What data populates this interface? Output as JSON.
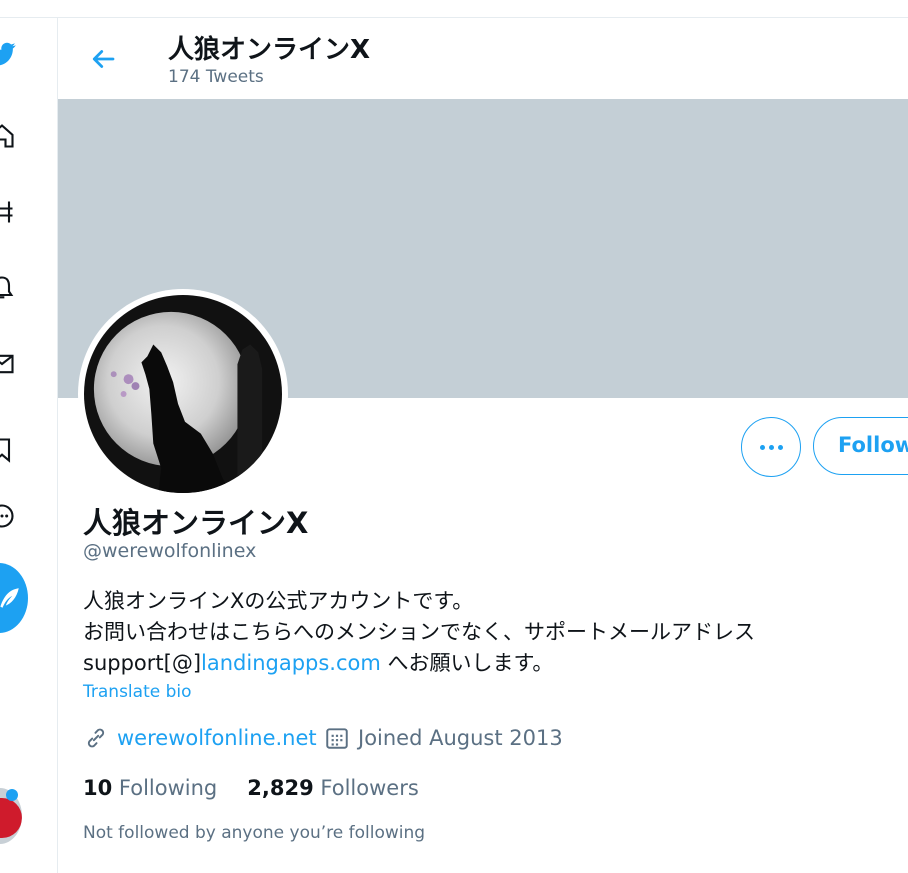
{
  "header": {
    "title": "人狼オンラインX",
    "tweet_count": "174 Tweets"
  },
  "profile": {
    "name": "人狼オンラインX",
    "handle": "@werewolfonlinex",
    "bio_line1": "人狼オンラインXの公式アカウントです。",
    "bio_line2": "お問い合わせはこちらへのメンションでなく、サポートメールアドレス",
    "bio_line3_prefix": "support[@]",
    "bio_line3_link": "landingapps.com",
    "bio_line3_suffix": " へお願いします。",
    "translate": "Translate bio",
    "website": "werewolfonline.net",
    "joined": "Joined August 2013",
    "following_count": "10",
    "following_label": "Following",
    "followers_count": "2,829",
    "followers_label": "Followers",
    "not_followed": "Not followed by anyone you’re following"
  },
  "actions": {
    "follow_label": "Follow"
  },
  "icons": [
    "twitter-logo-icon",
    "home-icon",
    "explore-icon",
    "notifications-icon",
    "messages-icon",
    "bookmarks-icon",
    "more-circle-icon",
    "compose-tweet-icon",
    "back-arrow-icon",
    "more-dots-icon",
    "link-icon",
    "calendar-icon"
  ],
  "colors": {
    "accent": "#1da1f2",
    "banner": "#c4cfd6",
    "secondary_text": "#5b7083"
  }
}
